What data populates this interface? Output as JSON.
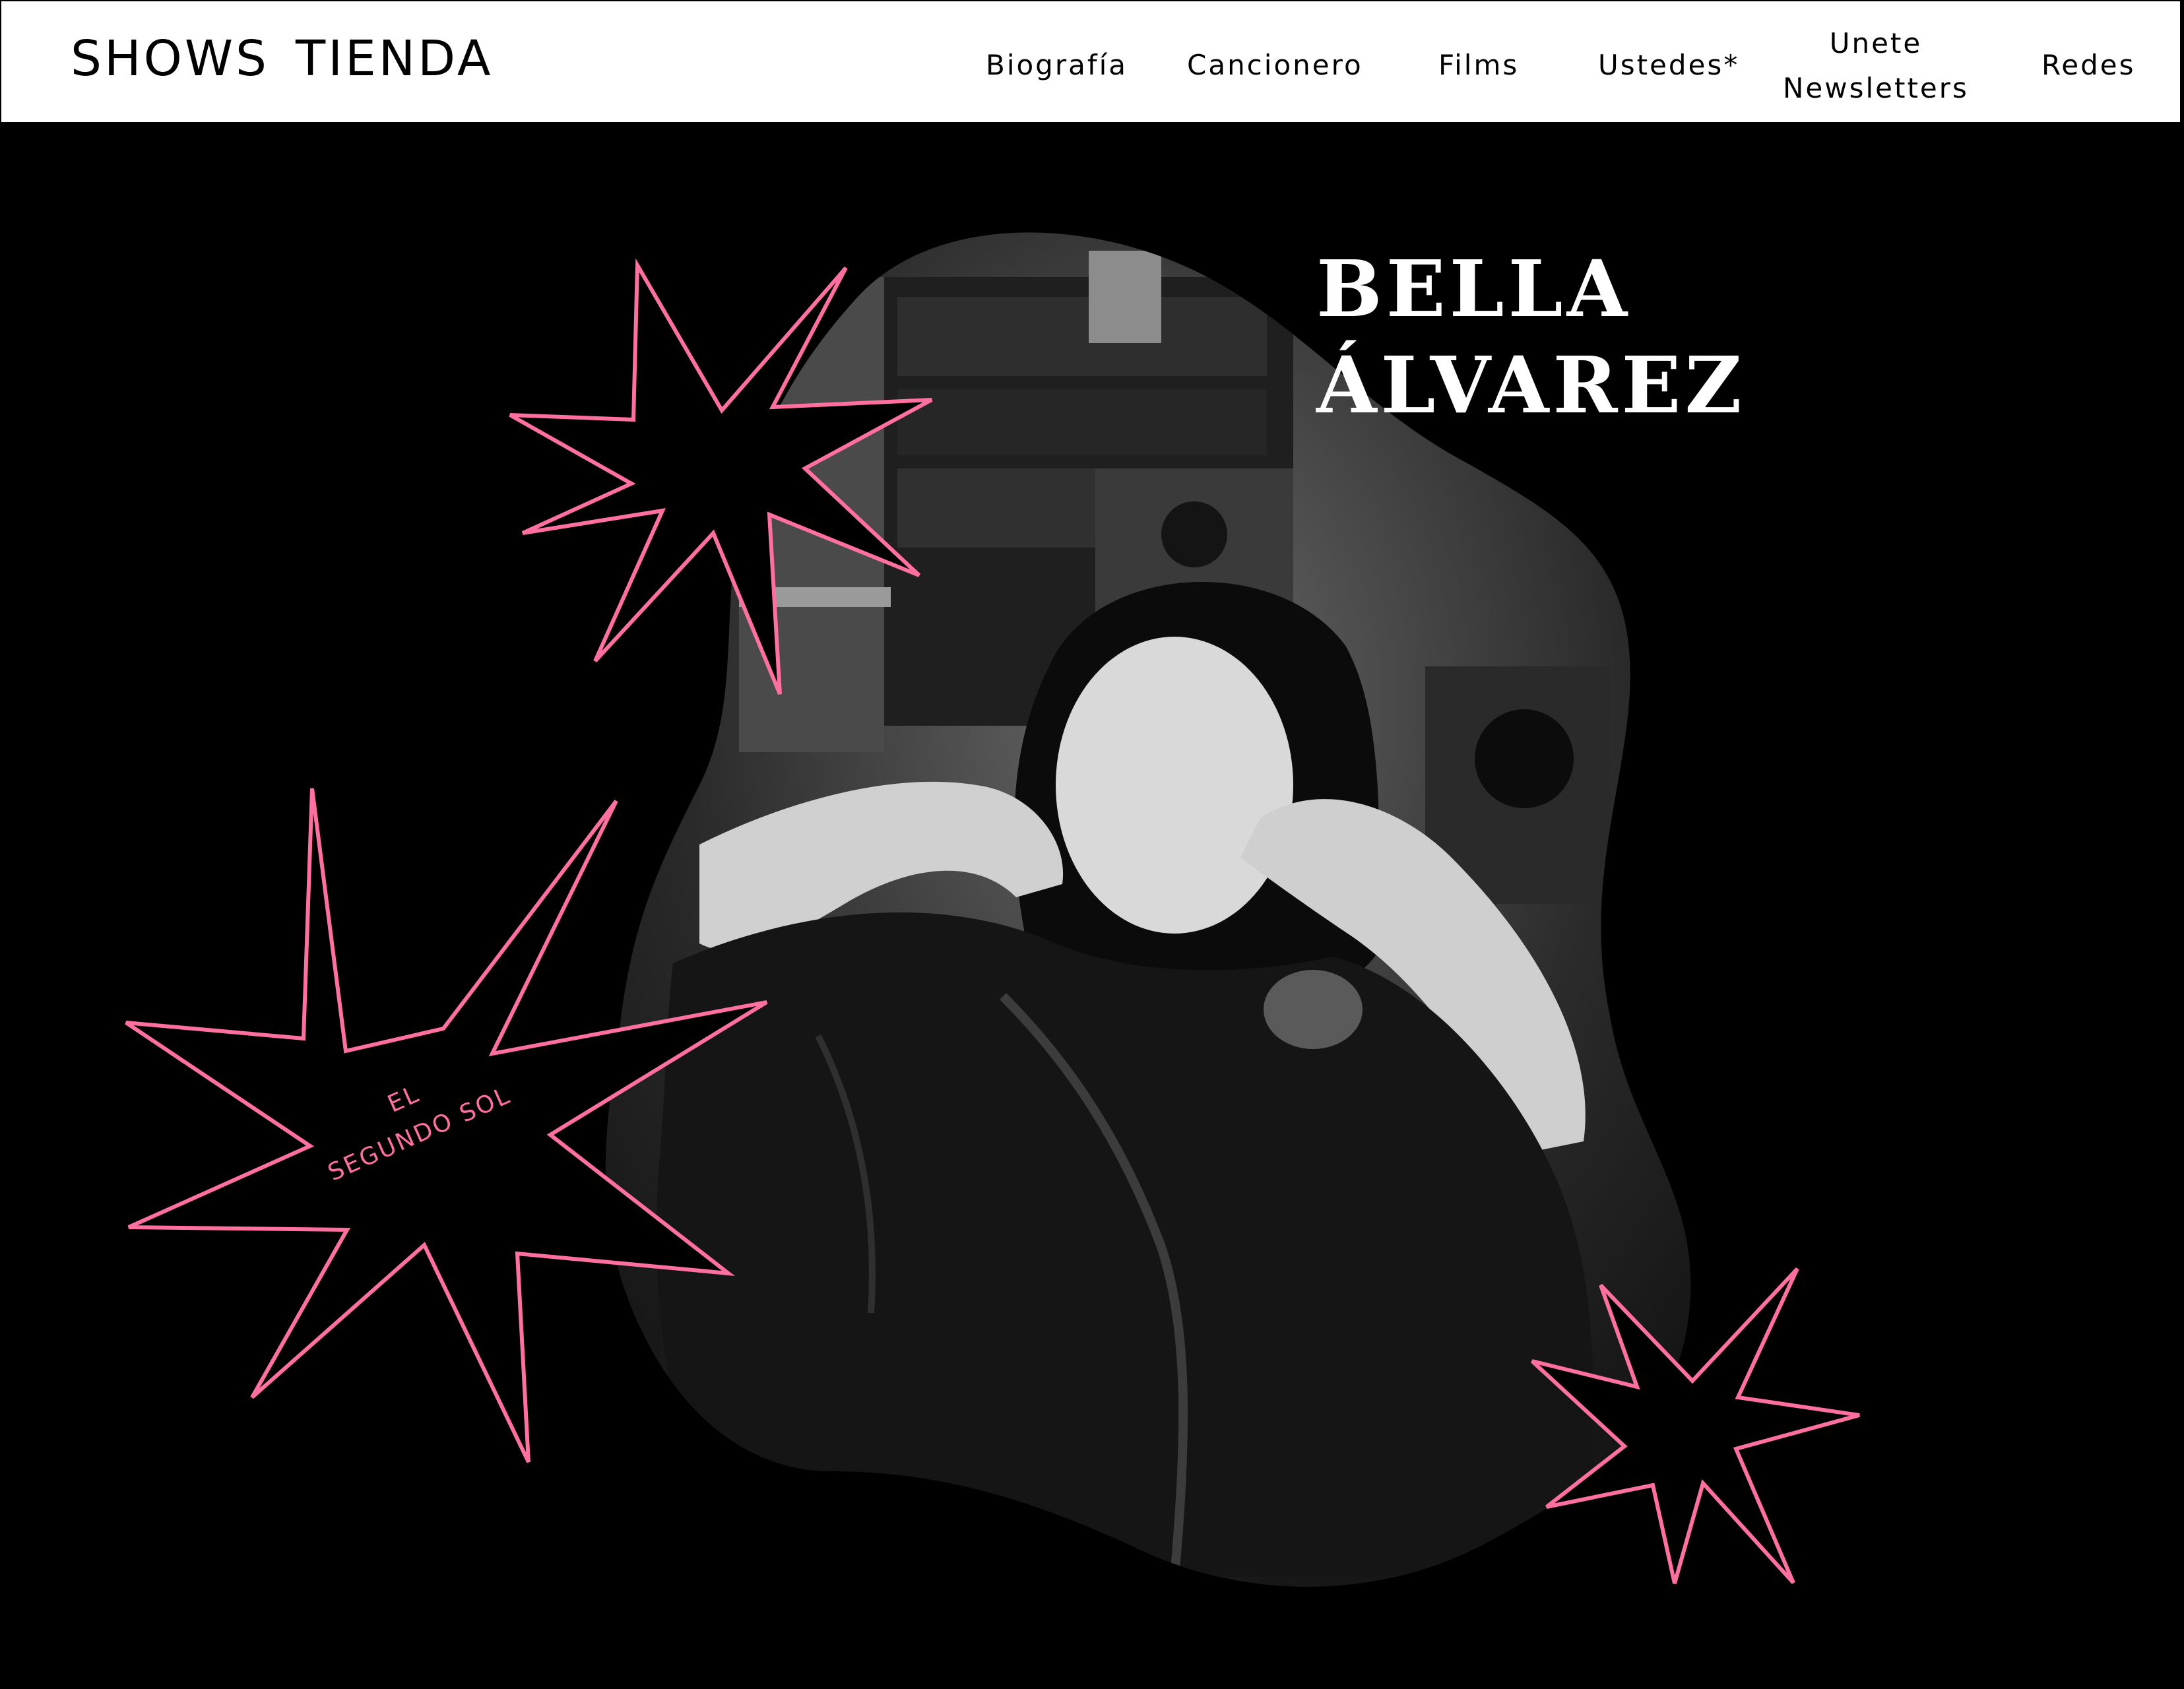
{
  "header": {
    "brand_links": [
      "SHOWS",
      "TIENDA"
    ],
    "nav": {
      "biografia": "Biografía",
      "cancionero": "Cancionero",
      "films": "Films",
      "ustedes": "Ustedes*",
      "unete_line1": "Unete",
      "unete_line2": "Newsletters",
      "redes": "Redes"
    }
  },
  "hero": {
    "artist_name_line1": "BELLA",
    "artist_name_line2": "ÁLVAREZ",
    "album_line1": "EL",
    "album_line2": "SEGUNDO SOL",
    "photo": "black-and-white portrait of the artist in a music studio"
  },
  "colors": {
    "background": "#000000",
    "header_bg": "#ffffff",
    "accent_pink": "#ff6fa0",
    "text_light": "#ffffff"
  },
  "icons": [
    "star-burst-icon"
  ]
}
